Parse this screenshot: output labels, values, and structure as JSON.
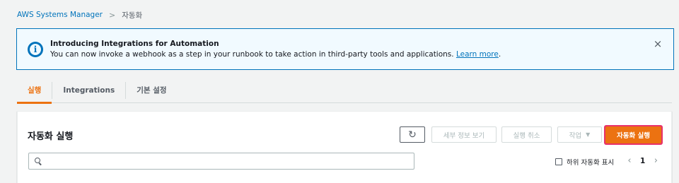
{
  "breadcrumb": {
    "root": "AWS Systems Manager",
    "separator": ">",
    "current": "자동화"
  },
  "flash": {
    "icon": "info-icon",
    "title": "Introducing Integrations for Automation",
    "body": "You can now invoke a webhook as a step in your runbook to take action in third-party tools and applications.",
    "link": "Learn more",
    "trailing": ".",
    "close": "×"
  },
  "tabs": [
    {
      "label": "실행",
      "active": true
    },
    {
      "label": "Integrations",
      "active": false
    },
    {
      "label": "기본 설정",
      "active": false
    }
  ],
  "panel": {
    "title": "자동화 실행",
    "refresh_icon": "↻",
    "buttons": {
      "detail": "세부 정보 보기",
      "cancel": "실행 취소",
      "action": "작업",
      "action_caret": "▼",
      "primary": "자동화 실행"
    },
    "search": {
      "placeholder": "",
      "value": ""
    },
    "sub_automation_label": "하위 자동화 표시",
    "pagination": {
      "prev": "‹",
      "page": "1",
      "next": "›"
    }
  },
  "colors": {
    "accent": "#ec7211",
    "link": "#0073bb",
    "highlight": "#e8316b"
  }
}
